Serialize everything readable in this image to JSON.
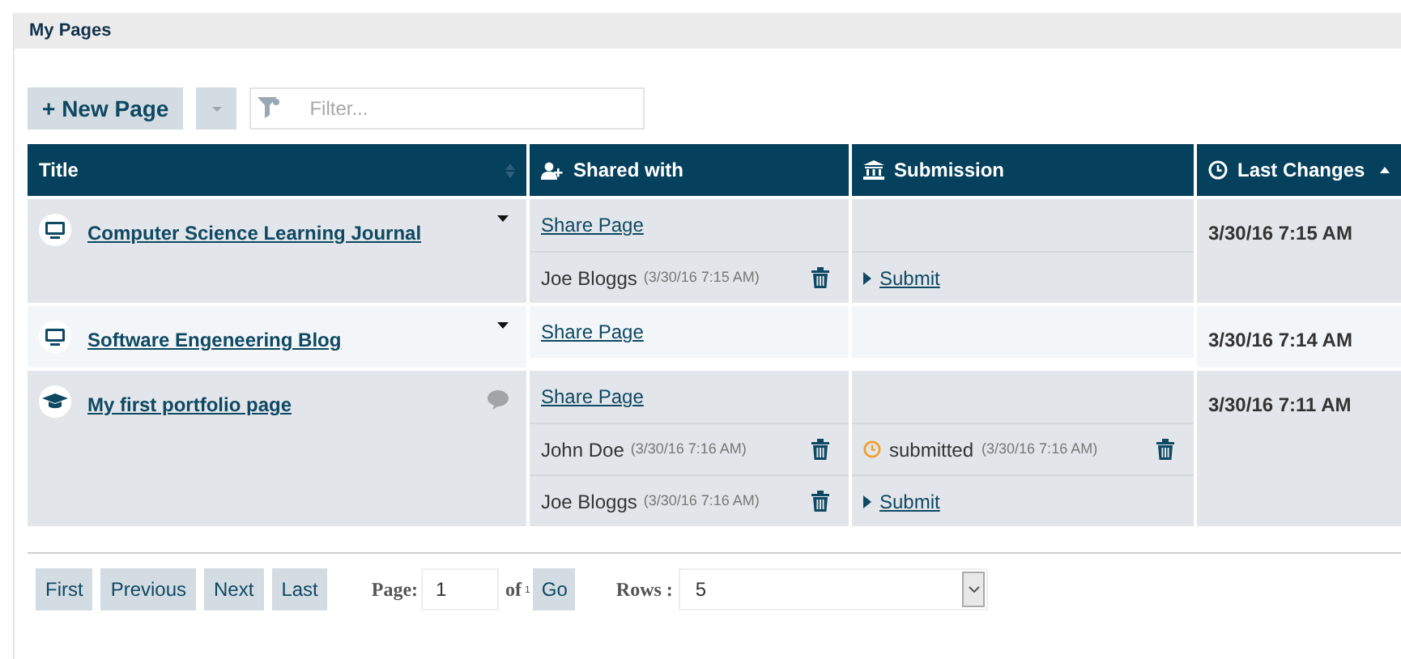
{
  "panel": {
    "title": "My Pages"
  },
  "toolbar": {
    "new_button": "+ New Page",
    "filter": {
      "placeholder": "Filter..."
    }
  },
  "table": {
    "columns": [
      {
        "kind": "title",
        "label": "Title"
      },
      {
        "kind": "shared",
        "label": "Shared with"
      },
      {
        "kind": "submission",
        "label": "Submission"
      },
      {
        "kind": "changes",
        "label": "Last Changes"
      }
    ],
    "rows": [
      {
        "kind": "blog",
        "title": "Computer Science Learning Journal",
        "last_change": "3/30/16 7:15 AM",
        "shares": [
          {
            "kind": "link",
            "label": "Share Page"
          },
          {
            "kind": "person",
            "name": "Joe Bloggs",
            "date": "(3/30/16 7:15 AM)",
            "submission": {
              "kind": "submit",
              "label": "Submit"
            }
          }
        ]
      },
      {
        "kind": "blog",
        "title": "Software Engeneering Blog",
        "last_change": "3/30/16 7:14 AM",
        "shares": [
          {
            "kind": "link",
            "label": "Share Page"
          }
        ]
      },
      {
        "kind": "portfolio",
        "title": "My first portfolio page",
        "last_change": "3/30/16 7:11 AM",
        "shares": [
          {
            "kind": "link",
            "label": "Share Page"
          },
          {
            "kind": "person",
            "name": "John Doe",
            "date": "(3/30/16 7:16 AM)",
            "submission": {
              "kind": "submitted",
              "label": "submitted",
              "date": "(3/30/16 7:16 AM)"
            }
          },
          {
            "kind": "person",
            "name": "Joe Bloggs",
            "date": "(3/30/16 7:16 AM)",
            "submission": {
              "kind": "submit",
              "label": "Submit"
            }
          }
        ]
      }
    ]
  },
  "pager": {
    "buttons": [
      "First",
      "Previous",
      "Next",
      "Last"
    ],
    "page_label": "Page:",
    "page_value": "1",
    "of_label": "of",
    "of_total": "1",
    "go": "Go",
    "rows_label": "Rows :",
    "rows_value": "5"
  }
}
